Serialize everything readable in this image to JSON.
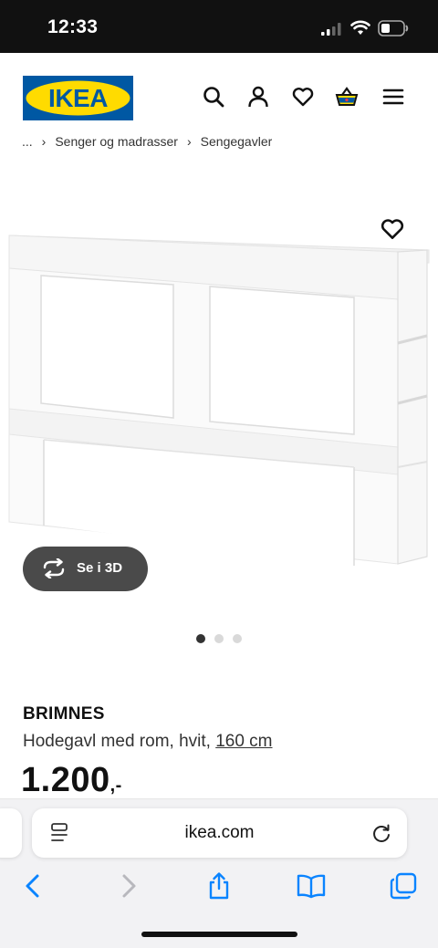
{
  "status_bar": {
    "time": "12:33"
  },
  "header": {
    "logo_text": "IKEA",
    "icons": [
      "search-icon",
      "user-icon",
      "heart-icon",
      "basket-icon",
      "menu-icon"
    ]
  },
  "breadcrumb": [
    "...",
    "Senger og madrasser",
    "Sengegavler"
  ],
  "gallery": {
    "view_3d_label": "Se i 3D",
    "dots_total": 3,
    "dots_active_index": 0
  },
  "product": {
    "name": "BRIMNES",
    "description": "Hodegavl med rom, hvit,",
    "size_link": "160 cm",
    "price": "1.200",
    "price_suffix": ",-"
  },
  "browser": {
    "url": "ikea.com",
    "nav_icons": [
      "back-icon",
      "forward-icon",
      "share-icon",
      "bookmarks-icon",
      "tabs-icon"
    ]
  },
  "colors": {
    "ikea_blue": "#0058a3",
    "ikea_yellow": "#ffdb00",
    "dark_button": "#4a4a4a",
    "safari_blue": "#0a84ff"
  }
}
